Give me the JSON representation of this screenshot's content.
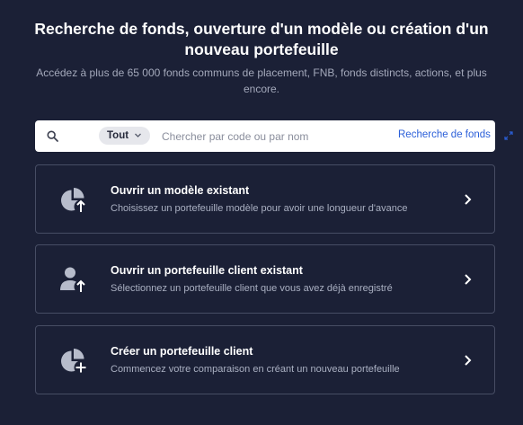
{
  "header": {
    "title": "Recherche de fonds, ouverture d'un modèle ou création d'un nouveau portefeuille",
    "subtitle": "Accédez à plus de 65 000 fonds communs de placement, FNB, fonds distincts, actions, et plus encore."
  },
  "search": {
    "scope_label": "Tout",
    "placeholder": "Chercher par code ou par nom",
    "value": "",
    "fund_search_link": "Recherche de fonds"
  },
  "cards": [
    {
      "title": "Ouvrir un modèle existant",
      "description": "Choisissez un portefeuille modèle pour avoir une longueur d'avance",
      "icon": "pie-chart-arrow-icon"
    },
    {
      "title": "Ouvrir un portefeuille client existant",
      "description": "Sélectionnez un portefeuille client que vous avez déjà enregistré",
      "icon": "user-arrow-icon"
    },
    {
      "title": "Créer un portefeuille client",
      "description": "Commencez votre comparaison en créant un nouveau portefeuille",
      "icon": "pie-chart-plus-icon"
    }
  ],
  "colors": {
    "background": "#1b2036",
    "card_border": "#474d64",
    "link": "#2b5fd9",
    "icon": "#b7bccb"
  }
}
